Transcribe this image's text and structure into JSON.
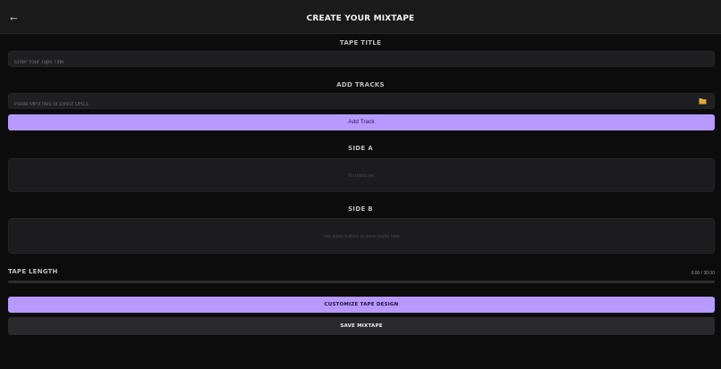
{
  "header": {
    "back_icon": "arrow-left-icon",
    "back_glyph": "←",
    "title": "CREATE YOUR MIXTAPE"
  },
  "tape_title": {
    "label": "TAPE TITLE",
    "value": "",
    "placeholder": "Enter Your Tape Title"
  },
  "add_tracks": {
    "label": "ADD TRACKS",
    "value": "",
    "placeholder": "Paste MP3 files or Direct URLs",
    "folder_icon": "folder-icon",
    "button_label": "Add Track"
  },
  "side_a": {
    "label": "SIDE A",
    "empty_text": "No tracks yet"
  },
  "side_b": {
    "label": "SIDE B",
    "empty_text": "Use arrow buttons to move tracks here"
  },
  "tape_length": {
    "label": "TAPE LENGTH",
    "value_text": "0:00 / 30:00",
    "progress": 0
  },
  "actions": {
    "customize_label": "CUSTOMIZE TAPE DESIGN",
    "save_label": "SAVE MIXTAPE"
  },
  "colors": {
    "accent": "#b799ff",
    "background": "#0c0c0d",
    "header": "#1a1a1b",
    "folder": "#f2c14e"
  }
}
